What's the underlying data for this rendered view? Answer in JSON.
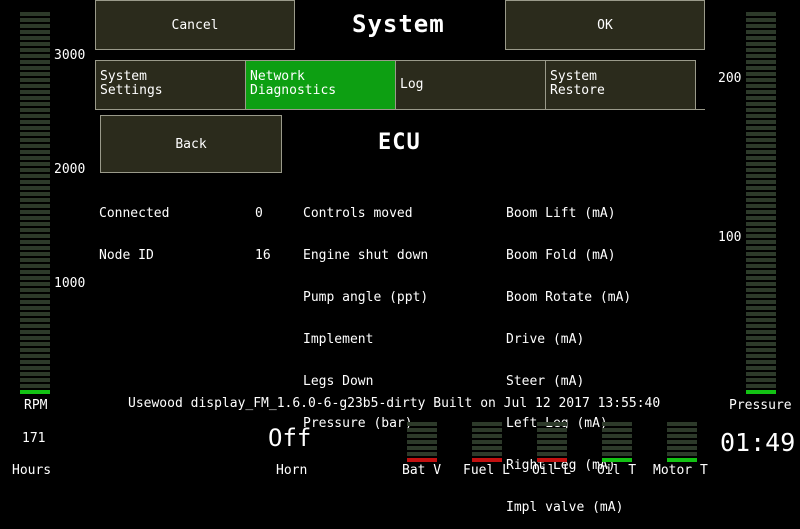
{
  "header": {
    "cancel_label": "Cancel",
    "title": "System",
    "ok_label": "OK"
  },
  "tabs": [
    {
      "line1": "System",
      "line2": "Settings",
      "active": false
    },
    {
      "line1": "Network",
      "line2": "Diagnostics",
      "active": true
    },
    {
      "line1": "Log",
      "line2": "",
      "active": false
    },
    {
      "line1": "System",
      "line2": "Restore",
      "active": false
    }
  ],
  "panel": {
    "back_label": "Back",
    "section_title": "ECU",
    "status_labels": [
      "Connected",
      "Node ID"
    ],
    "status_values": [
      "0",
      "16"
    ],
    "inputs": [
      "Controls moved",
      "Engine shut down",
      "Pump angle (ppt)",
      "Implement",
      "Legs Down",
      "Pressure (bar)"
    ],
    "outputs": [
      "Boom Lift (mA)",
      "Boom Fold (mA)",
      "Boom Rotate (mA)",
      "Drive (mA)",
      "Steer (mA)",
      "Left Leg (mA)",
      "Right Leg (mA)",
      "Impl valve (mA)"
    ]
  },
  "gauges": {
    "rpm": {
      "label": "RPM",
      "ticks": [
        "3000",
        "2000",
        "1000"
      ],
      "level": 0.02
    },
    "pressure": {
      "label": "Pressure",
      "ticks": [
        "200",
        "100"
      ],
      "level": 0.02
    }
  },
  "build_info": "Usewood display_FM_1.6.0-6-g23b5-dirty Built on Jul 12 2017 13:55:40",
  "bottom": {
    "hours_value": "171",
    "hours_label": "Hours",
    "horn_value": "Off",
    "horn_label": "Horn",
    "time": "01:49",
    "indicators": [
      {
        "label": "Bat V",
        "state": "red"
      },
      {
        "label": "Fuel L",
        "state": "red"
      },
      {
        "label": "Oil L",
        "state": "red"
      },
      {
        "label": "Oil T",
        "state": "green"
      },
      {
        "label": "Motor T",
        "state": "green"
      }
    ]
  },
  "colors": {
    "active_tab": "#0d9f12",
    "button_bg": "#2b2b1c",
    "bar_on": "#13c214",
    "bar_off": "#2d3a2a",
    "alarm": "#c21010"
  }
}
